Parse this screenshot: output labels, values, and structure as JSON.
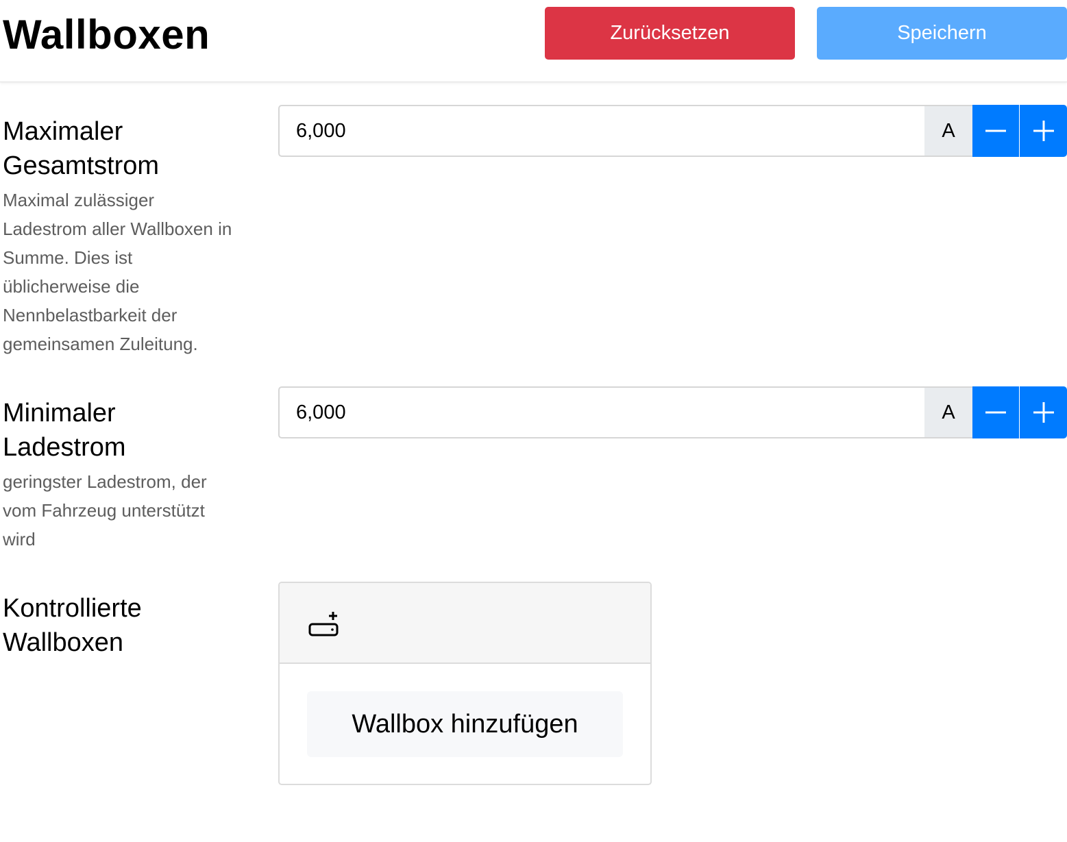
{
  "header": {
    "title": "Wallboxen",
    "reset_label": "Zurücksetzen",
    "save_label": "Speichern",
    "colors": {
      "reset": "#dc3545",
      "save": "#5aabfe"
    }
  },
  "fields": [
    {
      "title": "Maximaler Gesamtstrom",
      "description": "Maximal zulässiger Ladestrom aller Wallboxen in Summe. Dies ist üblicherweise die Nennbelastbarkeit der gemeinsamen Zuleitung.",
      "value": "6,000",
      "unit": "A"
    },
    {
      "title": "Minimaler Ladestrom",
      "description": "geringster Ladestrom, der vom Fahrzeug unterstützt wird",
      "value": "6,000",
      "unit": "A"
    }
  ],
  "wallboxes": {
    "title": "Kontrollierte Wallboxen",
    "add_icon": "add-wallbox-icon",
    "add_button_label": "Wallbox hinzufügen"
  },
  "icons": {
    "minus": "minus-icon",
    "plus": "plus-icon"
  },
  "accent": "#007bff"
}
